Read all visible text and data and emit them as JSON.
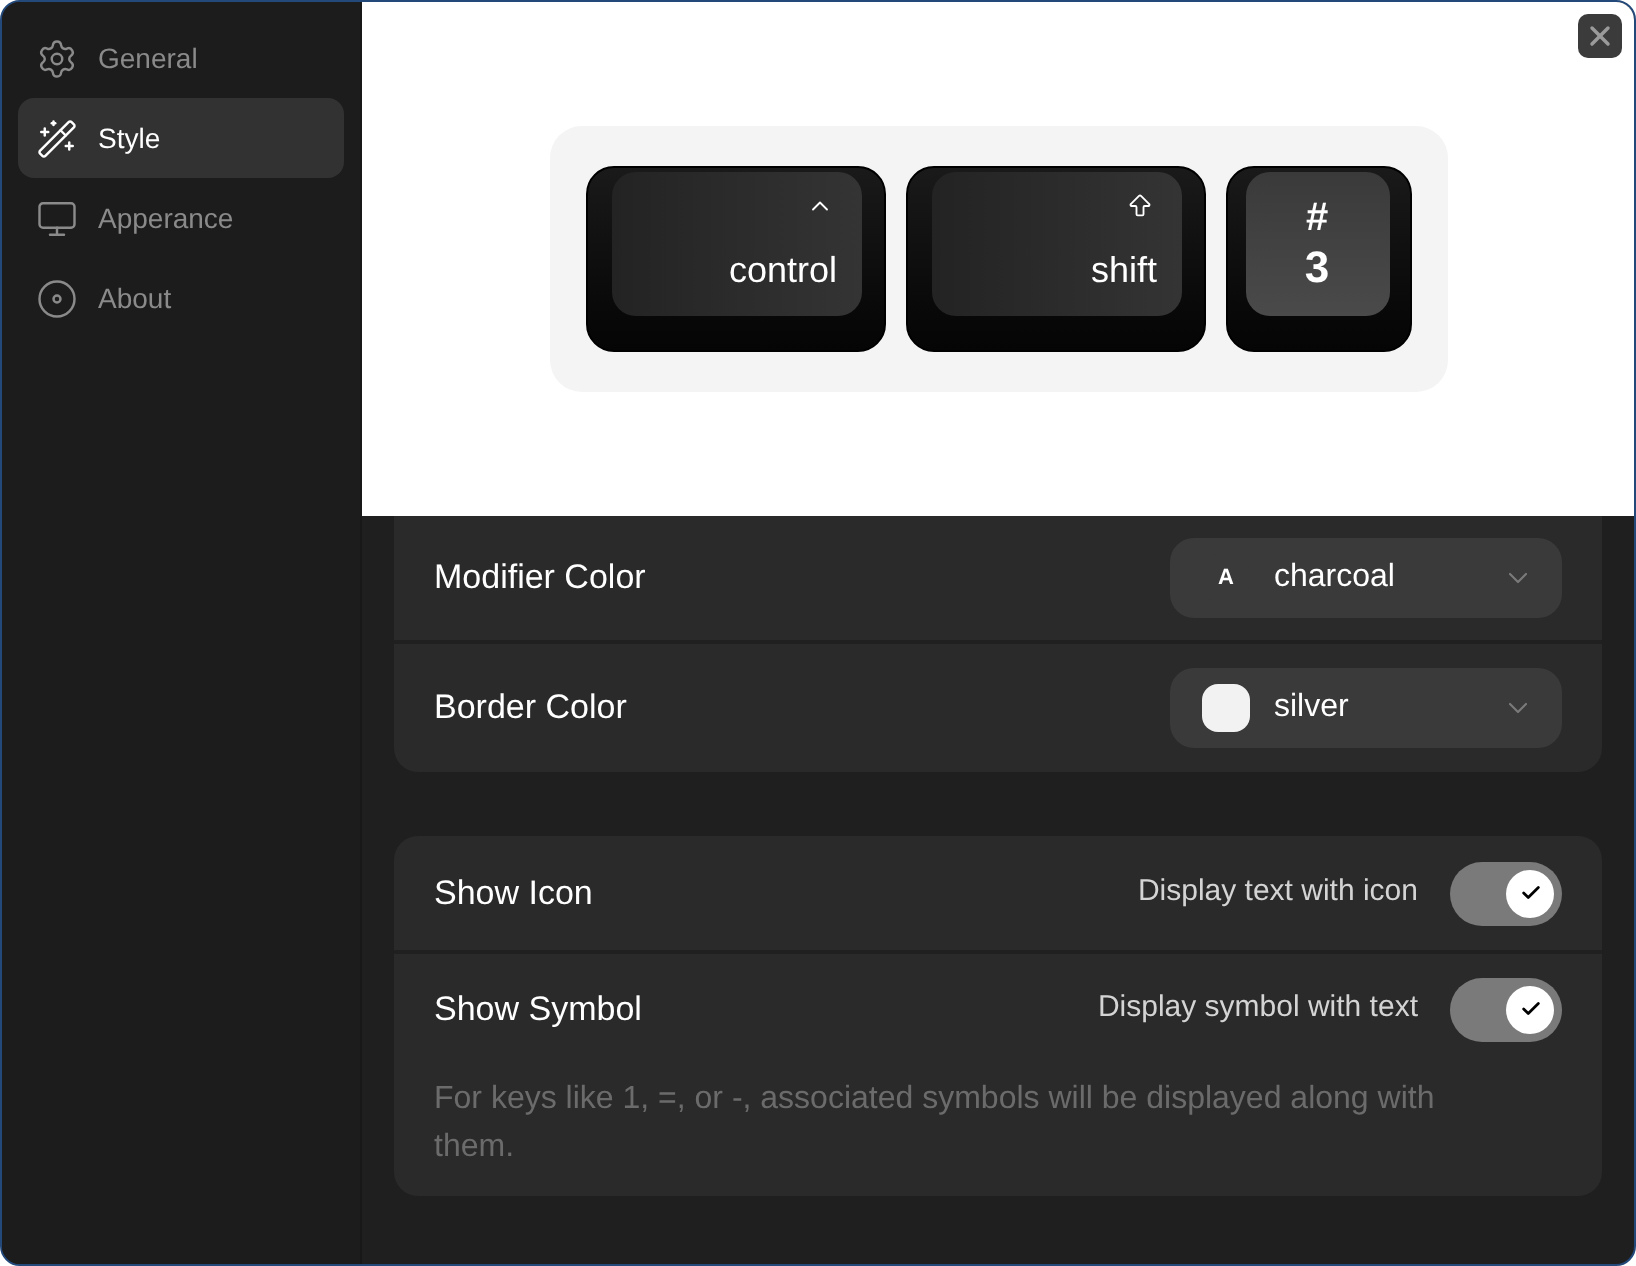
{
  "sidebar": {
    "items": [
      {
        "label": "General",
        "selected": false
      },
      {
        "label": "Style",
        "selected": true
      },
      {
        "label": "Apperance",
        "selected": false
      },
      {
        "label": "About",
        "selected": false
      }
    ]
  },
  "preview": {
    "keys": [
      {
        "kind": "control",
        "label": "control"
      },
      {
        "kind": "shift",
        "label": "shift"
      },
      {
        "kind": "character",
        "symbol": "#",
        "label": "3"
      }
    ]
  },
  "color_settings": [
    {
      "label": "Modifier Color",
      "value": "charcoal",
      "swatch_text": "A",
      "color": "#3a3a3a"
    },
    {
      "label": "Border Color",
      "value": "silver",
      "color": "#f2f2f2"
    }
  ],
  "display_settings": [
    {
      "label": "Show Icon",
      "description": "Display text with icon",
      "on": true
    },
    {
      "label": "Show Symbol",
      "description": "Display symbol with text",
      "on": true,
      "note": "For keys like 1, =, or -, associated symbols will be displayed along with them."
    }
  ]
}
